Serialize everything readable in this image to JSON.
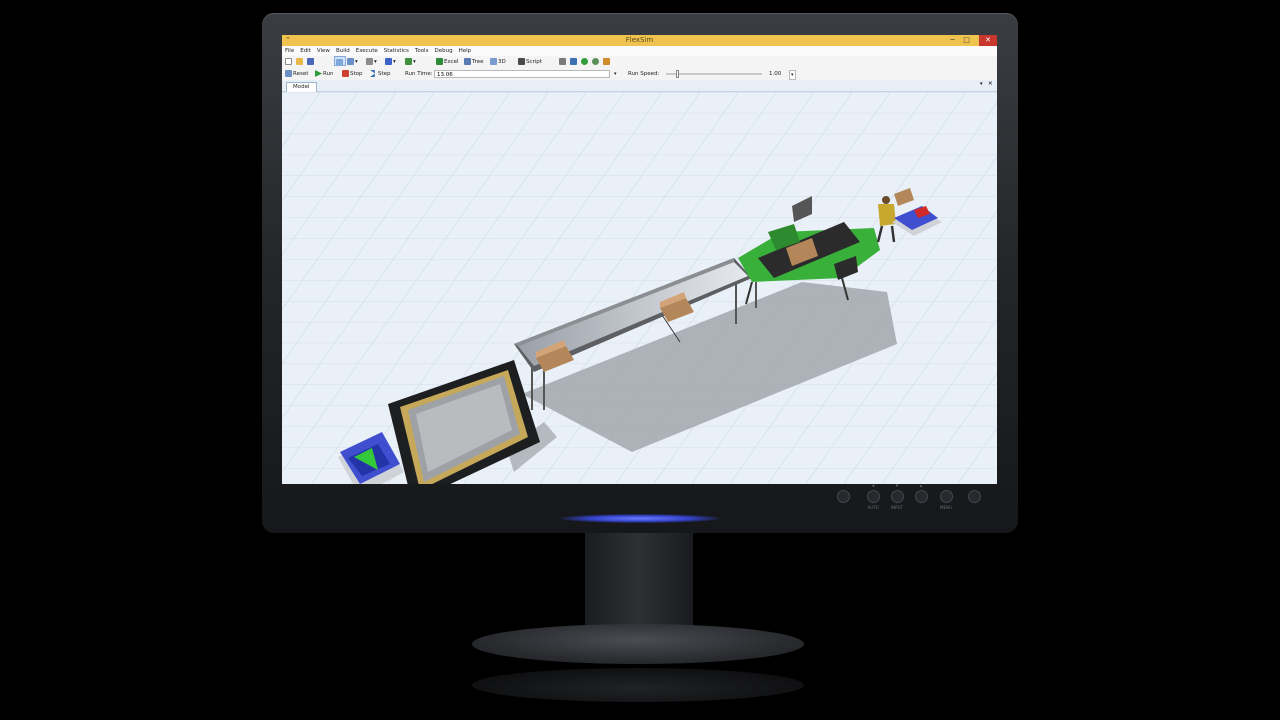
{
  "window": {
    "title": "FlexSim",
    "minimize_glyph": "─",
    "maximize_glyph": "□",
    "close_glyph": "✕",
    "app_icon_glyph": "⌃"
  },
  "menu": [
    "File",
    "Edit",
    "View",
    "Build",
    "Execute",
    "Statistics",
    "Tools",
    "Debug",
    "Help"
  ],
  "toolbar": {
    "excel_label": "Excel",
    "tree_label": "Tree",
    "threed_label": "3D",
    "script_label": "Script"
  },
  "run_controls": {
    "reset_label": "Reset",
    "run_label": "Run",
    "stop_label": "Stop",
    "step_label": "Step",
    "run_time_label": "Run Time:",
    "run_time_value": "13.06",
    "run_speed_label": "Run Speed:",
    "run_speed_value": "1.00",
    "run_speed_fraction": 0.1
  },
  "tabs": [
    {
      "label": "Model"
    }
  ],
  "monitor_buttons": {
    "auto_label": "AUTO",
    "input_label": "INPUT",
    "menu_label": "MENU"
  },
  "colors": {
    "titlebar": "#f0c24e",
    "close_button": "#c8372d",
    "machine_green": "#38b03a",
    "source_blue": "#3f4fcf",
    "box_brown": "#b4875a"
  },
  "icons": [
    "app-icon",
    "new-file-icon",
    "open-folder-icon",
    "save-icon",
    "pointer-icon",
    "connect-icon",
    "disconnect-icon",
    "object-icon",
    "flowitem-icon",
    "excel-icon",
    "tree-icon",
    "3d-icon",
    "script-icon",
    "reset-icon",
    "run-icon",
    "stop-icon",
    "step-icon"
  ]
}
